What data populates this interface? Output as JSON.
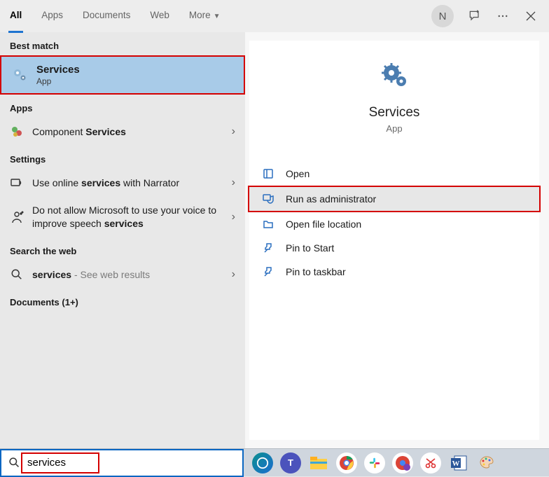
{
  "header": {
    "tabs": [
      "All",
      "Apps",
      "Documents",
      "Web",
      "More"
    ],
    "active_tab_index": 0,
    "avatar_initial": "N"
  },
  "left": {
    "best_match_label": "Best match",
    "best_match": {
      "title": "Services",
      "subtitle": "App"
    },
    "apps_label": "Apps",
    "apps": [
      {
        "label_pre": "Component ",
        "label_bold": "Services"
      }
    ],
    "settings_label": "Settings",
    "settings": [
      {
        "pre": "Use online ",
        "bold": "services",
        "post": " with Narrator"
      },
      {
        "pre": "Do not allow Microsoft to use your voice to improve speech ",
        "bold": "services",
        "post": ""
      }
    ],
    "web_label": "Search the web",
    "web": {
      "bold": "services",
      "muted": " - See web results"
    },
    "documents_label": "Documents (1+)"
  },
  "right": {
    "title": "Services",
    "subtitle": "App",
    "actions": [
      {
        "label": "Open",
        "icon": "open"
      },
      {
        "label": "Run as administrator",
        "icon": "admin",
        "highlighted": true
      },
      {
        "label": "Open file location",
        "icon": "folder"
      },
      {
        "label": "Pin to Start",
        "icon": "pin"
      },
      {
        "label": "Pin to taskbar",
        "icon": "pin"
      }
    ]
  },
  "taskbar": {
    "search_value": "services",
    "tray": [
      "edge",
      "teams",
      "explorer",
      "chrome",
      "slack",
      "chrome2",
      "snip",
      "word",
      "paint"
    ]
  }
}
